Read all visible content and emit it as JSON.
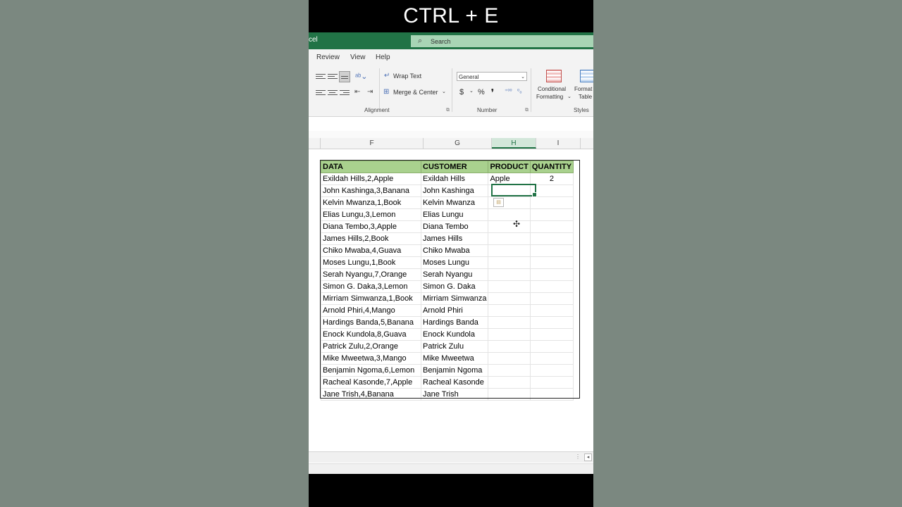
{
  "caption": "CTRL + E",
  "titlebar": {
    "app_name": "cel",
    "search_placeholder": "Search"
  },
  "menu": [
    "Review",
    "View",
    "Help"
  ],
  "ribbon": {
    "wrap_text": "Wrap Text",
    "merge_center": "Merge & Center",
    "number_format": "General",
    "alignment_label": "Alignment",
    "number_label": "Number",
    "styles_label": "Styles",
    "conditional_formatting": [
      "Conditional",
      "Formatting"
    ],
    "format_table": [
      "Format",
      "Table"
    ],
    "currency": "$",
    "percent": "%",
    "comma": "❜"
  },
  "columns": [
    "F",
    "G",
    "H",
    "I"
  ],
  "selected_column": "H",
  "table": {
    "headers": [
      "DATA",
      "CUSTOMER",
      "PRODUCT",
      "QUANTITY"
    ],
    "rows": [
      [
        "Exildah Hills,2,Apple",
        "Exildah Hills",
        "Apple",
        "2"
      ],
      [
        "John Kashinga,3,Banana",
        "John Kashinga",
        "",
        ""
      ],
      [
        "Kelvin Mwanza,1,Book",
        "Kelvin Mwanza",
        "",
        ""
      ],
      [
        "Elias Lungu,3,Lemon",
        "Elias Lungu",
        "",
        ""
      ],
      [
        "Diana Tembo,3,Apple",
        "Diana Tembo",
        "",
        ""
      ],
      [
        "James Hills,2,Book",
        "James Hills",
        "",
        ""
      ],
      [
        "Chiko Mwaba,4,Guava",
        "Chiko Mwaba",
        "",
        ""
      ],
      [
        "Moses Lungu,1,Book",
        "Moses Lungu",
        "",
        ""
      ],
      [
        "Serah Nyangu,7,Orange",
        "Serah Nyangu",
        "",
        ""
      ],
      [
        "Simon G. Daka,3,Lemon",
        "Simon G. Daka",
        "",
        ""
      ],
      [
        "Mirriam Simwanza,1,Book",
        "Mirriam Simwanza",
        "",
        ""
      ],
      [
        "Arnold Phiri,4,Mango",
        "Arnold Phiri",
        "",
        ""
      ],
      [
        "Hardings Banda,5,Banana",
        "Hardings Banda",
        "",
        ""
      ],
      [
        "Enock Kundola,8,Guava",
        "Enock Kundola",
        "",
        ""
      ],
      [
        "Patrick Zulu,2,Orange",
        "Patrick Zulu",
        "",
        ""
      ],
      [
        "Mike Mweetwa,3,Mango",
        "Mike Mweetwa",
        "",
        ""
      ],
      [
        "Benjamin Ngoma,6,Lemon",
        "Benjamin Ngoma",
        "",
        ""
      ],
      [
        "Racheal Kasonde,7,Apple",
        "Racheal Kasonde",
        "",
        ""
      ],
      [
        "Jane Trish,4,Banana",
        "Jane Trish",
        "",
        ""
      ]
    ]
  },
  "colors": {
    "excel_green": "#217346",
    "header_fill": "#a9d18e",
    "search_fill": "#a8d5b5"
  }
}
